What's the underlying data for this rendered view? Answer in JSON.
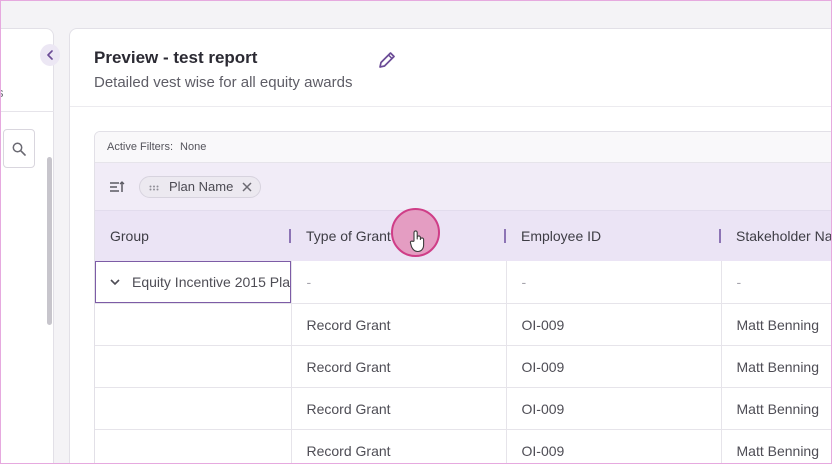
{
  "left_panel": {
    "fragment_text": "s",
    "search_icon": "search-icon",
    "collapse_icon": "chevron-left-icon"
  },
  "header": {
    "title": "Preview - test report",
    "subtitle": "Detailed vest wise for all equity awards",
    "edit_icon": "pencil-icon"
  },
  "filters": {
    "label": "Active Filters:",
    "value": "None"
  },
  "grouping": {
    "icon": "sort-lines-icon",
    "chip_label": "Plan Name",
    "chip_drag_icon": "drag-handle-icon",
    "chip_remove_icon": "close-icon"
  },
  "table": {
    "columns": [
      "Group",
      "Type of Grant",
      "Employee ID",
      "Stakeholder Nam"
    ],
    "group_row": {
      "label": "Equity Incentive 2015 Pla",
      "placeholders": [
        "-",
        "-",
        "-"
      ]
    },
    "rows": [
      {
        "type": "Record Grant",
        "employee_id": "OI-009",
        "stakeholder": "Matt Benning"
      },
      {
        "type": "Record Grant",
        "employee_id": "OI-009",
        "stakeholder": "Matt Benning"
      },
      {
        "type": "Record Grant",
        "employee_id": "OI-009",
        "stakeholder": "Matt Benning"
      },
      {
        "type": "Record Grant",
        "employee_id": "OI-009",
        "stakeholder": "Matt Benning"
      }
    ]
  },
  "colors": {
    "accent": "#6b4b96",
    "header_bg": "#ebe4f5",
    "cursor_highlight": "#cf3d87"
  }
}
